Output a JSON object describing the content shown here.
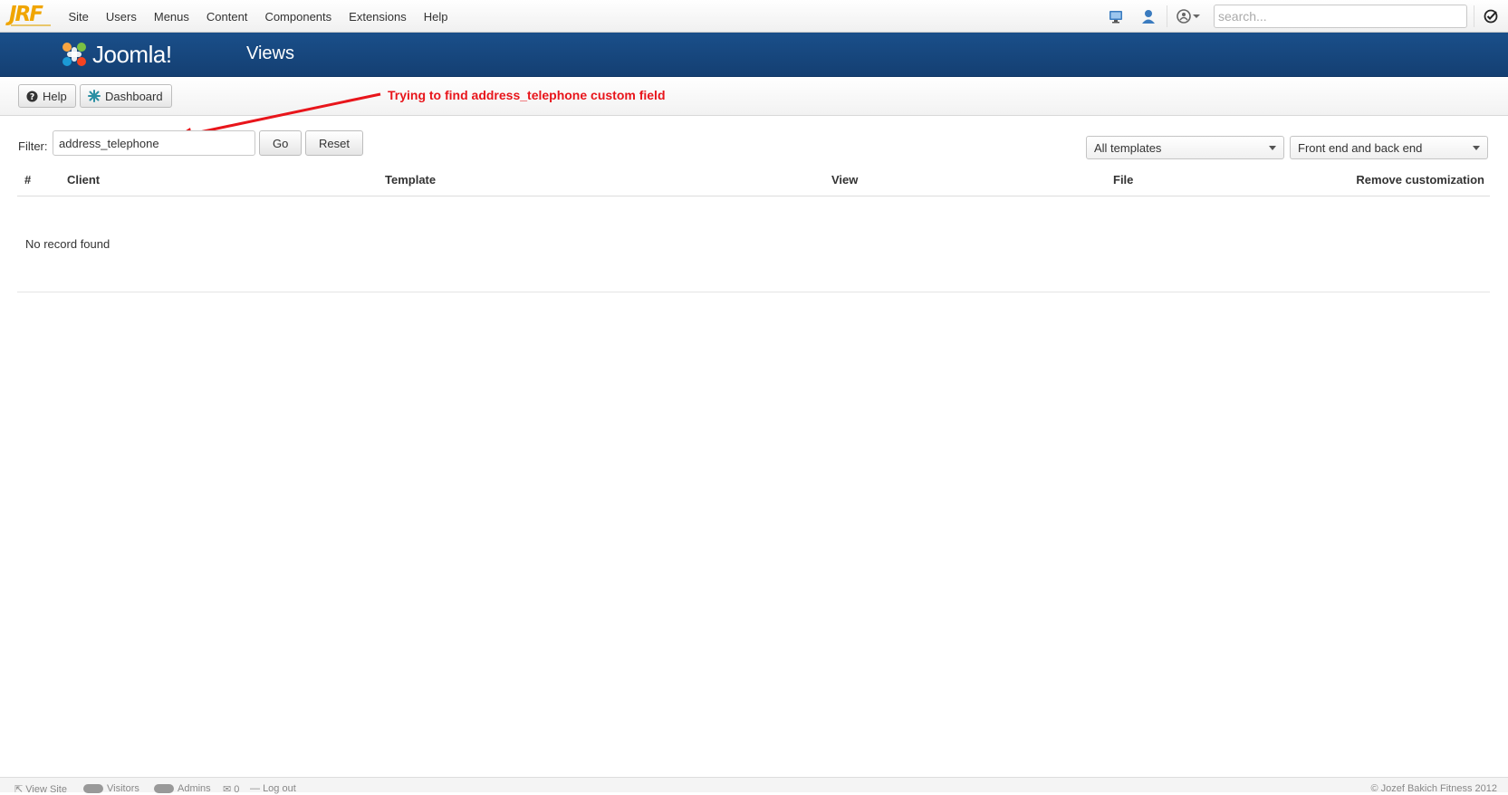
{
  "topbar": {
    "logo_text": "JRF",
    "menu": [
      "Site",
      "Users",
      "Menus",
      "Content",
      "Components",
      "Extensions",
      "Help"
    ],
    "icons": [
      "monitor-icon",
      "user-icon",
      "joomla-user-menu-icon",
      "chevron-down-icon",
      "checkin-icon"
    ],
    "search_placeholder": "search..."
  },
  "header": {
    "brand": "Joomla!",
    "title": "Views",
    "brand_color": "#1a4f8a"
  },
  "toolbar": {
    "help_label": "Help",
    "dashboard_label": "Dashboard"
  },
  "annotation": {
    "text": "Trying to find address_telephone custom field",
    "color": "#e8151b"
  },
  "filter": {
    "label": "Filter:",
    "value": "address_telephone",
    "go_label": "Go",
    "reset_label": "Reset",
    "template_select": "All templates",
    "client_select": "Front end and back end"
  },
  "table": {
    "columns": [
      "#",
      "Client",
      "Template",
      "View",
      "File",
      "Remove customization"
    ],
    "empty_message": "No record found"
  },
  "footer": {
    "view_site": "View Site",
    "visitors": "Visitors",
    "admins": "Admins",
    "messages": "0",
    "logout": "Log out",
    "copyright": "© Jozef Bakich Fitness 2012"
  }
}
